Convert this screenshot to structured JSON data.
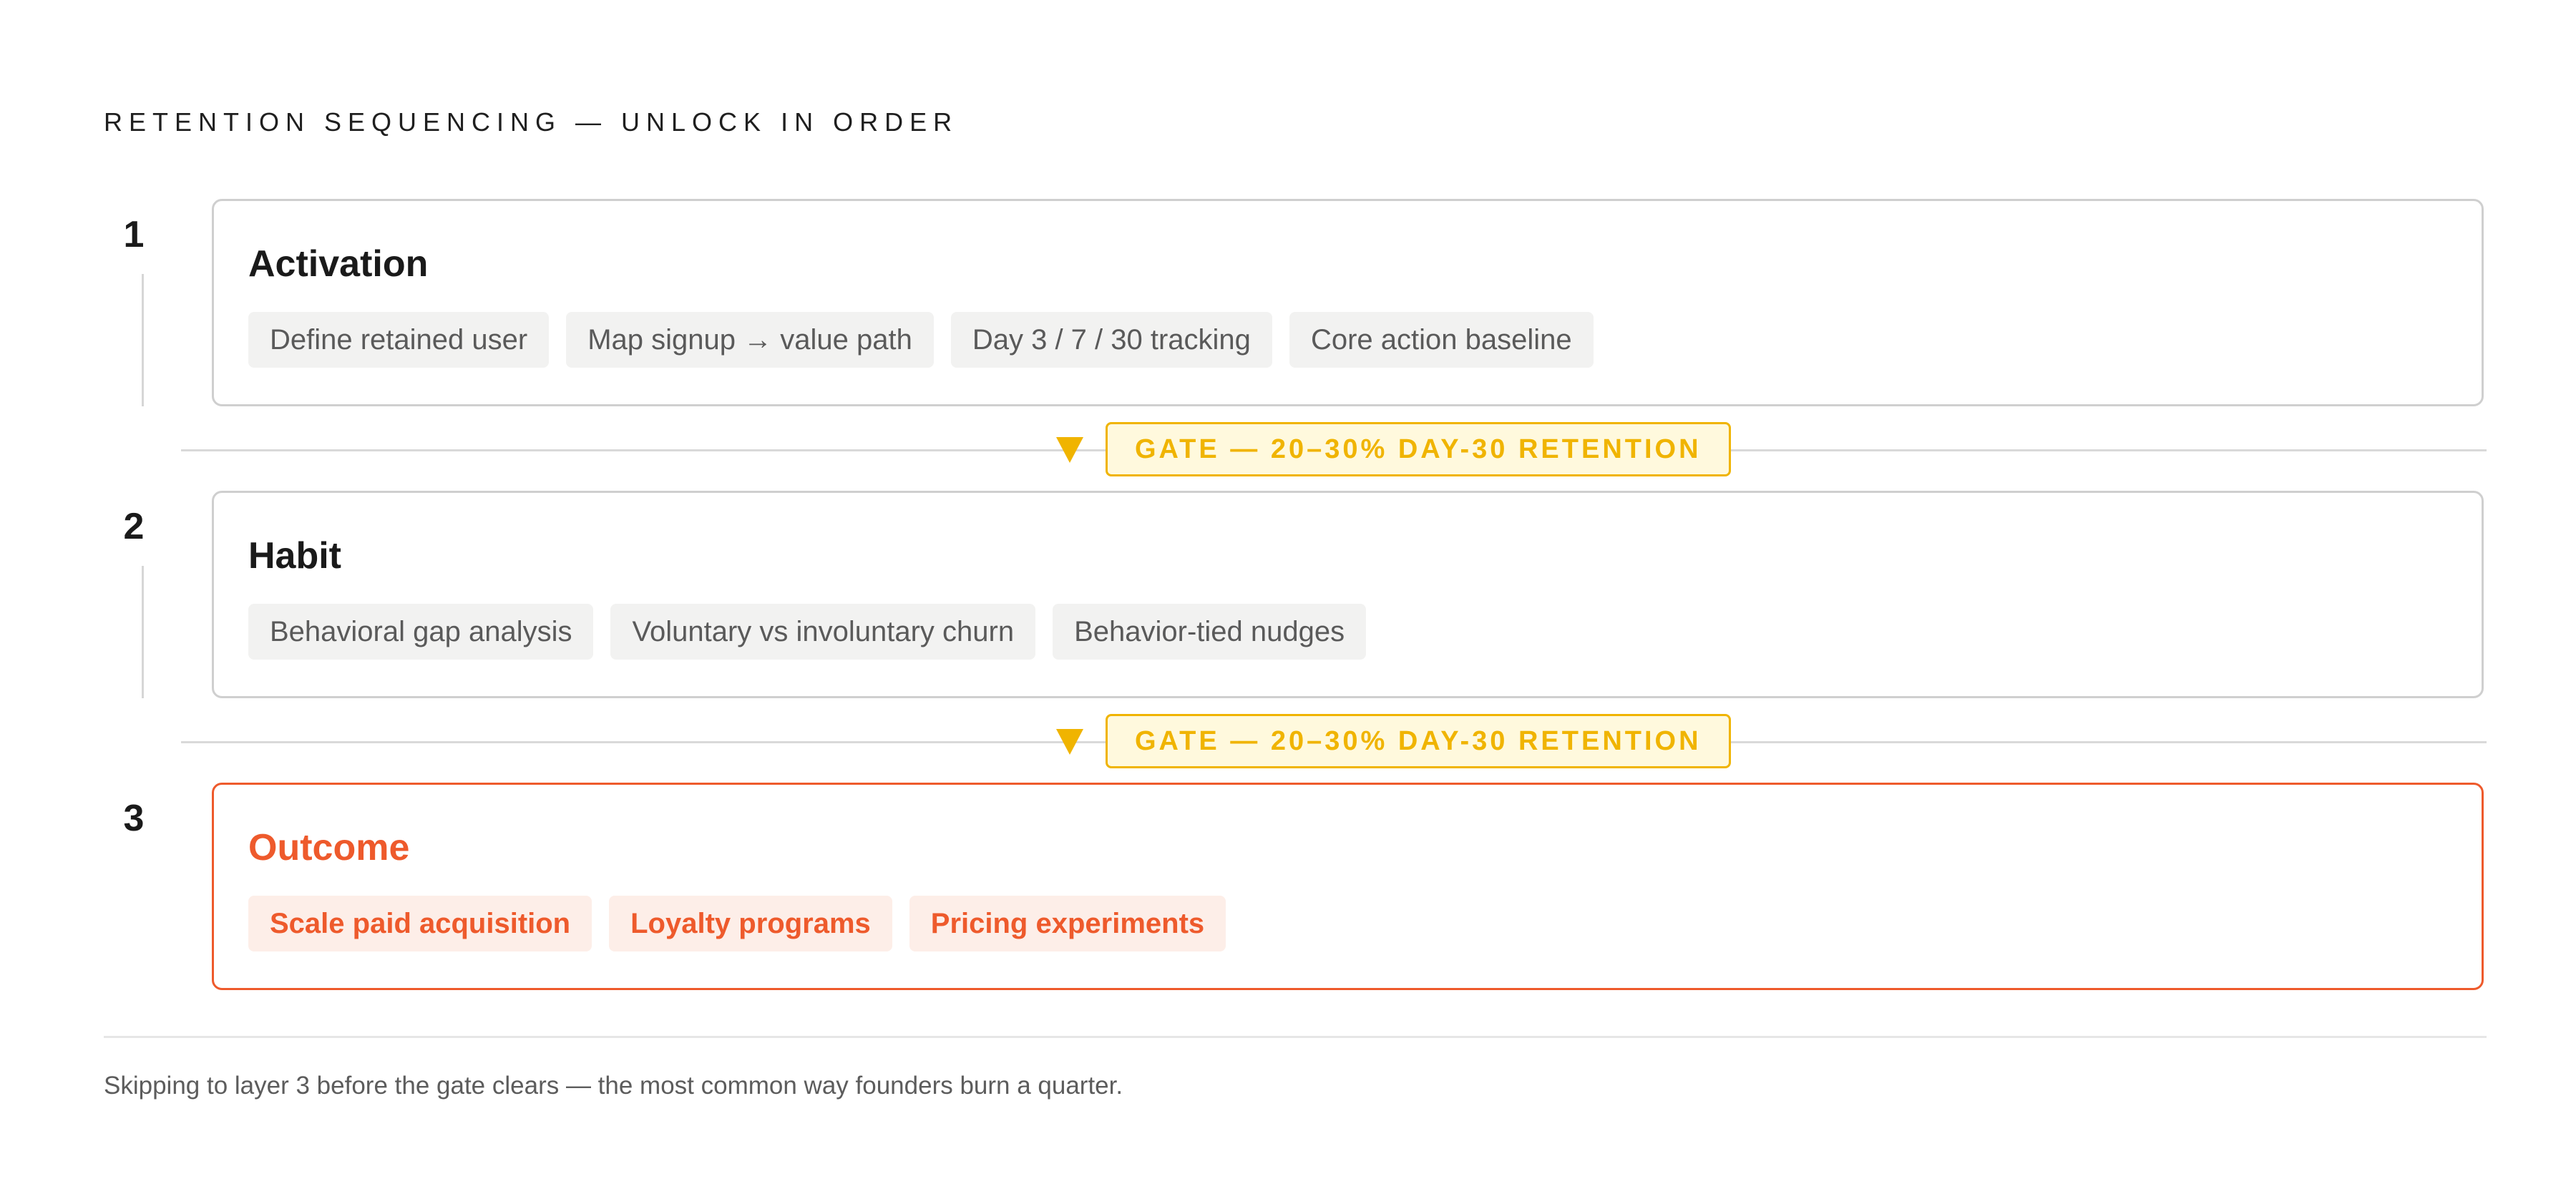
{
  "heading": "RETENTION SEQUENCING — UNLOCK IN ORDER",
  "layers": [
    {
      "number": "1",
      "title": "Activation",
      "items": [
        "Define retained user",
        "Map signup → value path",
        "Day 3 / 7 / 30 tracking",
        "Core action baseline"
      ]
    },
    {
      "number": "2",
      "title": "Habit",
      "items": [
        "Behavioral gap analysis",
        "Voluntary vs involuntary churn",
        "Behavior-tied nudges"
      ]
    },
    {
      "number": "3",
      "title": "Outcome",
      "items": [
        "Scale paid acquisition",
        "Loyalty programs",
        "Pricing experiments"
      ]
    }
  ],
  "gates": [
    {
      "label": "GATE — 20–30% DAY-30 RETENTION"
    },
    {
      "label": "GATE — 20–30% DAY-30 RETENTION"
    }
  ],
  "footnote": "Skipping to layer 3 before the gate clears — the most common way founders burn a quarter.",
  "colors": {
    "accent": "#ee5a2c",
    "gate": "#f0b400",
    "gate_fill": "#fff9dd",
    "chip_fill": "#f2f2f1",
    "border": "#cfcfcf"
  }
}
